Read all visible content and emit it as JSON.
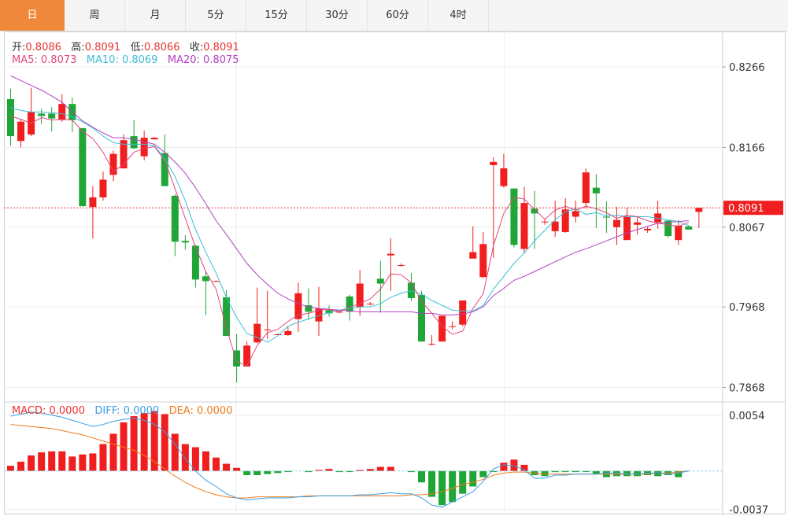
{
  "tabs": [
    "日",
    "周",
    "月",
    "5分",
    "15分",
    "30分",
    "60分",
    "4时"
  ],
  "active_tab": 0,
  "ohlc_info": {
    "open_label": "开:",
    "open": "0.8086",
    "high_label": "高:",
    "high": "0.8091",
    "low_label": "低:",
    "low": "0.8066",
    "close_label": "收:",
    "close": "0.8091"
  },
  "ma_info": {
    "ma5": "MA5: 0.8073",
    "ma10": "MA10: 0.8069",
    "ma20": "MA20: 0.8075"
  },
  "macd_info": {
    "macd": "MACD: 0.0000",
    "diff": "DIFF: 0.0000",
    "dea": "DEA: 0.0000"
  },
  "price_axis_ticks": [
    "0.8266",
    "0.8166",
    "0.8067",
    "0.7968",
    "0.7868"
  ],
  "price_axis_values": [
    0.8266,
    0.8166,
    0.8067,
    0.7968,
    0.7868
  ],
  "current_price_label": "0.8091",
  "macd_axis_ticks": [
    "0.0054",
    "-0.0037"
  ],
  "macd_axis_values": [
    0.0054,
    -0.0037
  ],
  "colors": {
    "up": "#f01e1e",
    "down": "#1fa637",
    "ma5": "#e0487f",
    "ma10": "#3bbfd6",
    "ma20": "#b340c4",
    "diff": "#3aa0e6",
    "dea": "#f07b1a",
    "active_tab": "#f0883c"
  },
  "chart_data": {
    "type": "candlestick",
    "y_range": [
      0.785,
      0.831
    ],
    "macd_range": [
      -0.0042,
      0.0066
    ],
    "candles": [
      [
        0.8226,
        0.818,
        0.8239,
        0.8168
      ],
      [
        0.8174,
        0.8198,
        0.8201,
        0.8166
      ],
      [
        0.8182,
        0.821,
        0.824,
        0.818
      ],
      [
        0.8208,
        0.8205,
        0.8214,
        0.8195
      ],
      [
        0.8208,
        0.8202,
        0.8216,
        0.8186
      ],
      [
        0.82,
        0.822,
        0.8232,
        0.8198
      ],
      [
        0.822,
        0.82,
        0.8228,
        0.8185
      ],
      [
        0.819,
        0.8093,
        0.819,
        0.8093
      ],
      [
        0.8092,
        0.8104,
        0.8118,
        0.8053
      ],
      [
        0.8104,
        0.8126,
        0.8136,
        0.81
      ],
      [
        0.8132,
        0.8158,
        0.8162,
        0.8124
      ],
      [
        0.814,
        0.8175,
        0.8182,
        0.814
      ],
      [
        0.818,
        0.8165,
        0.82,
        0.8164
      ],
      [
        0.8155,
        0.8178,
        0.8187,
        0.815
      ],
      [
        0.8176,
        0.8178,
        0.8179,
        0.8176
      ],
      [
        0.8159,
        0.8118,
        0.8182,
        0.8118
      ],
      [
        0.8106,
        0.8049,
        0.8108,
        0.8031
      ],
      [
        0.805,
        0.8048,
        0.8057,
        0.8039
      ],
      [
        0.8044,
        0.8002,
        0.8045,
        0.7992
      ],
      [
        0.8006,
        0.8,
        0.8012,
        0.7958
      ],
      [
        0.8,
        0.8,
        0.8001,
        0.7999
      ],
      [
        0.798,
        0.7932,
        0.7989,
        0.7932
      ],
      [
        0.7914,
        0.7894,
        0.7934,
        0.7874
      ],
      [
        0.7894,
        0.792,
        0.7925,
        0.7894
      ],
      [
        0.7924,
        0.7947,
        0.7992,
        0.7923
      ],
      [
        0.7939,
        0.794,
        0.7988,
        0.7928
      ],
      [
        0.7934,
        0.7934,
        0.7935,
        0.7933
      ],
      [
        0.7933,
        0.7938,
        0.7943,
        0.7932
      ],
      [
        0.7953,
        0.7985,
        0.7998,
        0.7937
      ],
      [
        0.797,
        0.7962,
        0.7991,
        0.7952
      ],
      [
        0.795,
        0.7966,
        0.7993,
        0.7932
      ],
      [
        0.7964,
        0.796,
        0.797,
        0.7956
      ],
      [
        0.7962,
        0.7962,
        0.7964,
        0.796
      ],
      [
        0.7981,
        0.7962,
        0.7983,
        0.7951
      ],
      [
        0.7968,
        0.7997,
        0.8014,
        0.7957
      ],
      [
        0.7972,
        0.7972,
        0.7974,
        0.797
      ],
      [
        0.8003,
        0.7997,
        0.8025,
        0.7961
      ],
      [
        0.8032,
        0.8034,
        0.8053,
        0.7988
      ],
      [
        0.8019,
        0.802,
        0.8022,
        0.8018
      ],
      [
        0.7998,
        0.7979,
        0.801,
        0.7975
      ],
      [
        0.7983,
        0.7925,
        0.7988,
        0.7925
      ],
      [
        0.7921,
        0.7922,
        0.7933,
        0.792
      ],
      [
        0.7925,
        0.7957,
        0.7957,
        0.7925
      ],
      [
        0.7944,
        0.7944,
        0.795,
        0.794
      ],
      [
        0.7946,
        0.7976,
        0.7976,
        0.7944
      ],
      [
        0.8028,
        0.8036,
        0.8068,
        0.8036
      ],
      [
        0.8005,
        0.8046,
        0.8061,
        0.8004
      ],
      [
        0.8144,
        0.8148,
        0.8154,
        0.8029
      ],
      [
        0.8118,
        0.814,
        0.8158,
        0.8116
      ],
      [
        0.8115,
        0.8045,
        0.8115,
        0.8042
      ],
      [
        0.804,
        0.8097,
        0.8117,
        0.8035
      ],
      [
        0.809,
        0.8084,
        0.8112,
        0.804
      ],
      [
        0.8073,
        0.8074,
        0.8078,
        0.807
      ],
      [
        0.8062,
        0.8074,
        0.81,
        0.8055
      ],
      [
        0.8061,
        0.8089,
        0.8103,
        0.806
      ],
      [
        0.808,
        0.8087,
        0.81,
        0.8073
      ],
      [
        0.8097,
        0.8135,
        0.814,
        0.8091
      ],
      [
        0.8116,
        0.8109,
        0.8133,
        0.8066
      ],
      [
        0.808,
        0.8079,
        0.8099,
        0.806
      ],
      [
        0.8067,
        0.8076,
        0.8092,
        0.8045
      ],
      [
        0.8051,
        0.808,
        0.8091,
        0.8064
      ],
      [
        0.807,
        0.8073,
        0.8081,
        0.8058
      ],
      [
        0.8063,
        0.8065,
        0.8067,
        0.806
      ],
      [
        0.8073,
        0.8084,
        0.81,
        0.8065
      ],
      [
        0.8075,
        0.8056,
        0.8076,
        0.8054
      ],
      [
        0.8051,
        0.8069,
        0.8076,
        0.8045
      ],
      [
        0.8068,
        0.8064,
        0.8069,
        0.8064
      ],
      [
        0.8086,
        0.8091,
        0.8091,
        0.8066
      ]
    ],
    "ma5": [
      0.8205,
      0.8201,
      0.8196,
      0.8203,
      0.82,
      0.8201,
      0.82,
      0.8186,
      0.8177,
      0.816,
      0.8136,
      0.8145,
      0.816,
      0.8165,
      0.8167,
      0.815,
      0.8115,
      0.8078,
      0.8042,
      0.8012,
      0.799,
      0.7942,
      0.79,
      0.7895,
      0.792,
      0.7936,
      0.794,
      0.795,
      0.7958,
      0.796,
      0.7964,
      0.7965,
      0.7962,
      0.7968,
      0.7972,
      0.7978,
      0.799,
      0.8009,
      0.8008,
      0.7998,
      0.7975,
      0.796,
      0.7944,
      0.7934,
      0.7938,
      0.7966,
      0.7984,
      0.8044,
      0.8084,
      0.8104,
      0.8102,
      0.8089,
      0.8077,
      0.8088,
      0.8093,
      0.8088,
      0.8093,
      0.809,
      0.8085,
      0.8078,
      0.8082,
      0.808,
      0.8075,
      0.8072,
      0.807,
      0.8068,
      0.8073
    ],
    "ma10": [
      0.8215,
      0.8212,
      0.821,
      0.821,
      0.8209,
      0.8208,
      0.8204,
      0.8198,
      0.819,
      0.818,
      0.8172,
      0.817,
      0.817,
      0.817,
      0.8168,
      0.8152,
      0.813,
      0.81,
      0.8064,
      0.8036,
      0.801,
      0.798,
      0.7955,
      0.7935,
      0.793,
      0.7924,
      0.7932,
      0.7944,
      0.7949,
      0.7953,
      0.7957,
      0.7961,
      0.7964,
      0.7966,
      0.7968,
      0.7968,
      0.7972,
      0.798,
      0.7985,
      0.7988,
      0.7984,
      0.7976,
      0.797,
      0.7964,
      0.7963,
      0.7963,
      0.797,
      0.799,
      0.8006,
      0.8022,
      0.8035,
      0.805,
      0.8063,
      0.8076,
      0.8086,
      0.809,
      0.8083,
      0.8085,
      0.8081,
      0.8082,
      0.808,
      0.808,
      0.808,
      0.8078,
      0.8076,
      0.8074,
      0.8069
    ],
    "ma20": [
      0.8255,
      0.8249,
      0.8243,
      0.8237,
      0.823,
      0.8222,
      0.821,
      0.8199,
      0.8191,
      0.8184,
      0.8178,
      0.8178,
      0.8176,
      0.8173,
      0.817,
      0.816,
      0.8148,
      0.8134,
      0.8116,
      0.8096,
      0.8075,
      0.8058,
      0.804,
      0.8022,
      0.8008,
      0.7996,
      0.7985,
      0.7978,
      0.7972,
      0.7968,
      0.7966,
      0.7965,
      0.7964,
      0.7963,
      0.7962,
      0.7962,
      0.7962,
      0.7962,
      0.7962,
      0.7962,
      0.796,
      0.796,
      0.7958,
      0.7958,
      0.7959,
      0.7962,
      0.7968,
      0.7982,
      0.7991,
      0.8001,
      0.8006,
      0.8012,
      0.8018,
      0.8024,
      0.803,
      0.8036,
      0.804,
      0.8045,
      0.805,
      0.8055,
      0.806,
      0.8064,
      0.8068,
      0.8072,
      0.8073,
      0.8074,
      0.8075
    ],
    "macd_hist": [
      0.0005,
      0.0009,
      0.0015,
      0.0018,
      0.0019,
      0.0019,
      0.0014,
      0.0016,
      0.0017,
      0.0026,
      0.0036,
      0.0047,
      0.0053,
      0.0056,
      0.0058,
      0.0055,
      0.0036,
      0.0026,
      0.0023,
      0.0019,
      0.0013,
      0.0007,
      0.0003,
      -0.0004,
      -0.0004,
      -0.0003,
      -0.0002,
      -0.0001,
      0.0,
      -0.0001,
      0.0001,
      0.0002,
      -0.0001,
      -0.0001,
      0.0001,
      0.0002,
      0.0004,
      0.0004,
      0.0,
      -0.0001,
      -0.0011,
      -0.0025,
      -0.0033,
      -0.003,
      -0.0022,
      -0.0015,
      -0.0006,
      -0.0001,
      0.0008,
      0.0011,
      0.0006,
      -0.0004,
      -0.0005,
      -0.0001,
      -0.0001,
      -0.0001,
      -0.0001,
      -0.0003,
      -0.0006,
      -0.0005,
      -0.0005,
      -0.0005,
      -0.0004,
      -0.0005,
      -0.0004,
      -0.0006,
      0.0
    ],
    "diff": [
      0.0053,
      0.0055,
      0.0057,
      0.0056,
      0.0054,
      0.0052,
      0.0049,
      0.0046,
      0.0043,
      0.0045,
      0.0048,
      0.005,
      0.0051,
      0.0049,
      0.0045,
      0.0038,
      0.0026,
      0.0012,
      0.0,
      -0.0009,
      -0.0015,
      -0.0022,
      -0.0026,
      -0.0028,
      -0.0027,
      -0.0026,
      -0.0026,
      -0.0026,
      -0.0025,
      -0.0025,
      -0.0024,
      -0.0024,
      -0.0024,
      -0.0024,
      -0.0023,
      -0.0023,
      -0.0022,
      -0.0021,
      -0.0022,
      -0.0022,
      -0.0026,
      -0.0033,
      -0.0035,
      -0.003,
      -0.0025,
      -0.002,
      -0.001,
      0.0002,
      0.0006,
      0.0005,
      0.0001,
      -0.0007,
      -0.0007,
      -0.0004,
      -0.0004,
      -0.0003,
      -0.0003,
      -0.0003,
      -0.0002,
      -0.0002,
      -0.0003,
      -0.0003,
      -0.0002,
      -0.0002,
      -0.0003,
      -0.0002,
      0.0
    ],
    "dea": [
      0.0045,
      0.0044,
      0.0043,
      0.0042,
      0.0041,
      0.0039,
      0.0037,
      0.0035,
      0.0032,
      0.0029,
      0.0026,
      0.0023,
      0.002,
      0.0015,
      0.0009,
      0.0002,
      -0.0005,
      -0.0011,
      -0.0016,
      -0.002,
      -0.0023,
      -0.0025,
      -0.0026,
      -0.0026,
      -0.0025,
      -0.0025,
      -0.0025,
      -0.0025,
      -0.0025,
      -0.0024,
      -0.0024,
      -0.0024,
      -0.0024,
      -0.0024,
      -0.0024,
      -0.0024,
      -0.0024,
      -0.0024,
      -0.0024,
      -0.0023,
      -0.0023,
      -0.0022,
      -0.002,
      -0.0017,
      -0.0013,
      -0.0011,
      -0.0008,
      -0.0004,
      -0.0002,
      -0.0001,
      -0.0001,
      -0.0002,
      -0.0003,
      -0.0003,
      -0.0003,
      -0.0003,
      -0.0003,
      -0.0003,
      -0.0003,
      -0.0003,
      -0.0003,
      -0.0003,
      -0.0003,
      -0.0002,
      -0.0002,
      -0.0001,
      0.0
    ]
  }
}
